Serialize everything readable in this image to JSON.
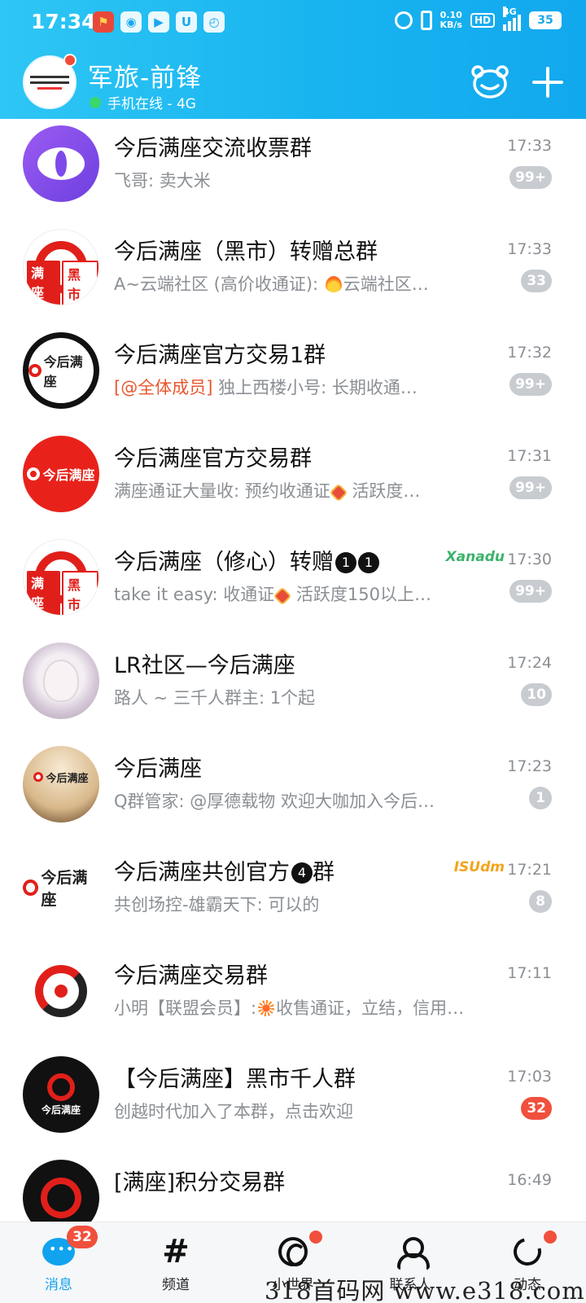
{
  "status_bar": {
    "time": "17:34",
    "net_speed_top": "0.10",
    "net_speed_unit": "KB/s",
    "hd": "HD",
    "network": "4G",
    "battery": "35"
  },
  "header": {
    "nickname": "军旅-前锋",
    "online_status": "手机在线 - 4G",
    "accent_color": "#18b4f0",
    "icons": [
      "bear-icon",
      "plus-icon"
    ]
  },
  "chats": [
    {
      "title": "今后满座交流收票群",
      "preview": "飞哥: 卖大米",
      "time": "17:33",
      "badge": "99+"
    },
    {
      "title": "今后满座（黑市）转赠总群",
      "preview_a": "A~云端社区 (高价收通证):",
      "preview_b": "云端社区…",
      "time": "17:33",
      "badge": "33"
    },
    {
      "title": "今后满座官方交易1群",
      "mention": "[@全体成员]",
      "preview": "独上西楼小号: 长期收通…",
      "time": "17:32",
      "badge": "99+"
    },
    {
      "title": "今后满座官方交易群",
      "preview_a": "满座通证大量收: 预约收通证",
      "preview_b": "活跃度…",
      "time": "17:31",
      "badge": "99+"
    },
    {
      "title": "今后满座（修心）转赠",
      "title_suffix": "❶❶",
      "tag": "Xanadu",
      "preview_a": "take it easy: 收通证",
      "preview_b": "活跃度150以上…",
      "time": "17:30",
      "badge": "99+"
    },
    {
      "title": "LR社区—今后满座",
      "preview": "路人 ~ 三千人群主: 1个起",
      "time": "17:24",
      "badge": "10"
    },
    {
      "title": "今后满座",
      "preview": "Q群管家: @厚德载物 欢迎大咖加入今后…",
      "time": "17:23",
      "badge": "1"
    },
    {
      "title_a": "今后满座共创官方",
      "title_num": "❹",
      "title_b": "群",
      "tag": "ISUdm",
      "preview": "共创场控-雄霸天下: 可以的",
      "time": "17:21",
      "badge": "8"
    },
    {
      "title": "今后满座交易群",
      "preview_a": "小明【联盟会员】:",
      "preview_b": "收售通证，立结，信用…",
      "time": "17:11"
    },
    {
      "title": "【今后满座】黑市千人群",
      "preview": "创越时代加入了本群，点击欢迎",
      "time": "17:03",
      "badge": "32",
      "badge_color": "#f0503c"
    },
    {
      "title": "[满座]积分交易群",
      "time": "16:49"
    }
  ],
  "avatar_logo_text": {
    "full_seat": "满座",
    "black_market": "黑市",
    "brand": "今后满座"
  },
  "tabs": [
    {
      "label": "消息",
      "icon": "message-icon",
      "badge": "32",
      "active": true
    },
    {
      "label": "频道",
      "icon": "hash-icon"
    },
    {
      "label": "小世界",
      "icon": "world-icon",
      "dot": true
    },
    {
      "label": "联系人",
      "icon": "contacts-icon"
    },
    {
      "label": "动态",
      "icon": "feed-icon",
      "dot": true
    }
  ],
  "watermark": "318首码网 www.e318.com"
}
